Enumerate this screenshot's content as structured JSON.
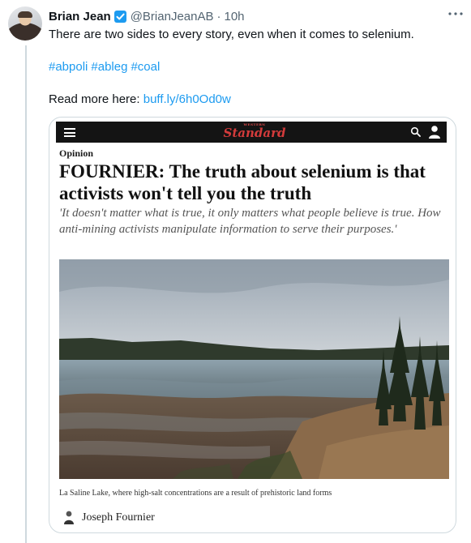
{
  "tweet": {
    "display_name": "Brian Jean",
    "handle": "@BrianJeanAB",
    "separator": "·",
    "timestamp": "10h",
    "text": "There are two sides to every story, even when it comes to selenium.",
    "hashtags": [
      "#abpoli",
      "#ableg",
      "#coal"
    ],
    "read_more_label": "Read more here:",
    "link_text": "buff.ly/6h0Od0w"
  },
  "card": {
    "site_logo_small": "WESTERN",
    "site_logo_main": "Standard",
    "category": "Opinion",
    "headline": "FOURNIER: The truth about selenium is that activists won't tell you the truth",
    "subhead": "'It doesn't matter what is true, it only matters what people believe is true. How anti-mining activists manipulate information to serve their purposes.'",
    "photo_caption": "La Saline Lake, where high-salt concentrations are a result of prehistoric land forms",
    "author_name": "Joseph Fournier"
  },
  "colors": {
    "accent": "#1d9bf0",
    "logo_red": "#d33b3b",
    "site_bar": "#141414",
    "muted": "#536471"
  },
  "icons": [
    "verified-badge-icon",
    "more-options-icon",
    "menu-icon",
    "search-icon",
    "user-icon"
  ]
}
